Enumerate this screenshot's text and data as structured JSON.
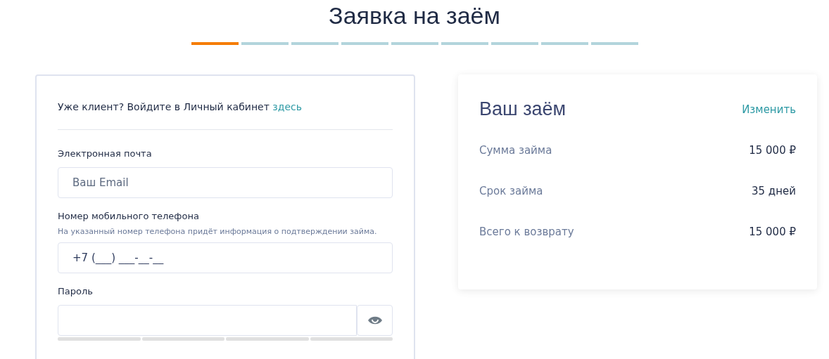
{
  "title": "Заявка на заём",
  "steps": [
    {
      "selected": true
    },
    {
      "selected": false
    },
    {
      "selected": false
    },
    {
      "selected": false
    },
    {
      "selected": false
    },
    {
      "selected": false
    },
    {
      "selected": false
    },
    {
      "selected": false
    },
    {
      "selected": false
    }
  ],
  "form": {
    "login_prompt": "Уже клиент? Войдите в Личный кабинет",
    "login_link": "здесь",
    "email": {
      "label": "Электронная почта",
      "placeholder": "Ваш Email"
    },
    "phone": {
      "label": "Номер мобильного телефона",
      "hint": "На указанный номер телефона придёт информация о подтверждении займа.",
      "value": "+7 (___) ___-__-__"
    },
    "password": {
      "label": "Пароль",
      "strength": {
        "level": 0
      }
    }
  },
  "summary": {
    "title": "Ваш заём",
    "edit_link": "Изменить",
    "rows": [
      {
        "label": "Сумма займа",
        "value": "15 000 ₽"
      },
      {
        "label": "Срок займа",
        "value": "35 дней"
      },
      {
        "label": "Всего к возврату",
        "value": "15 000 ₽"
      }
    ]
  }
}
